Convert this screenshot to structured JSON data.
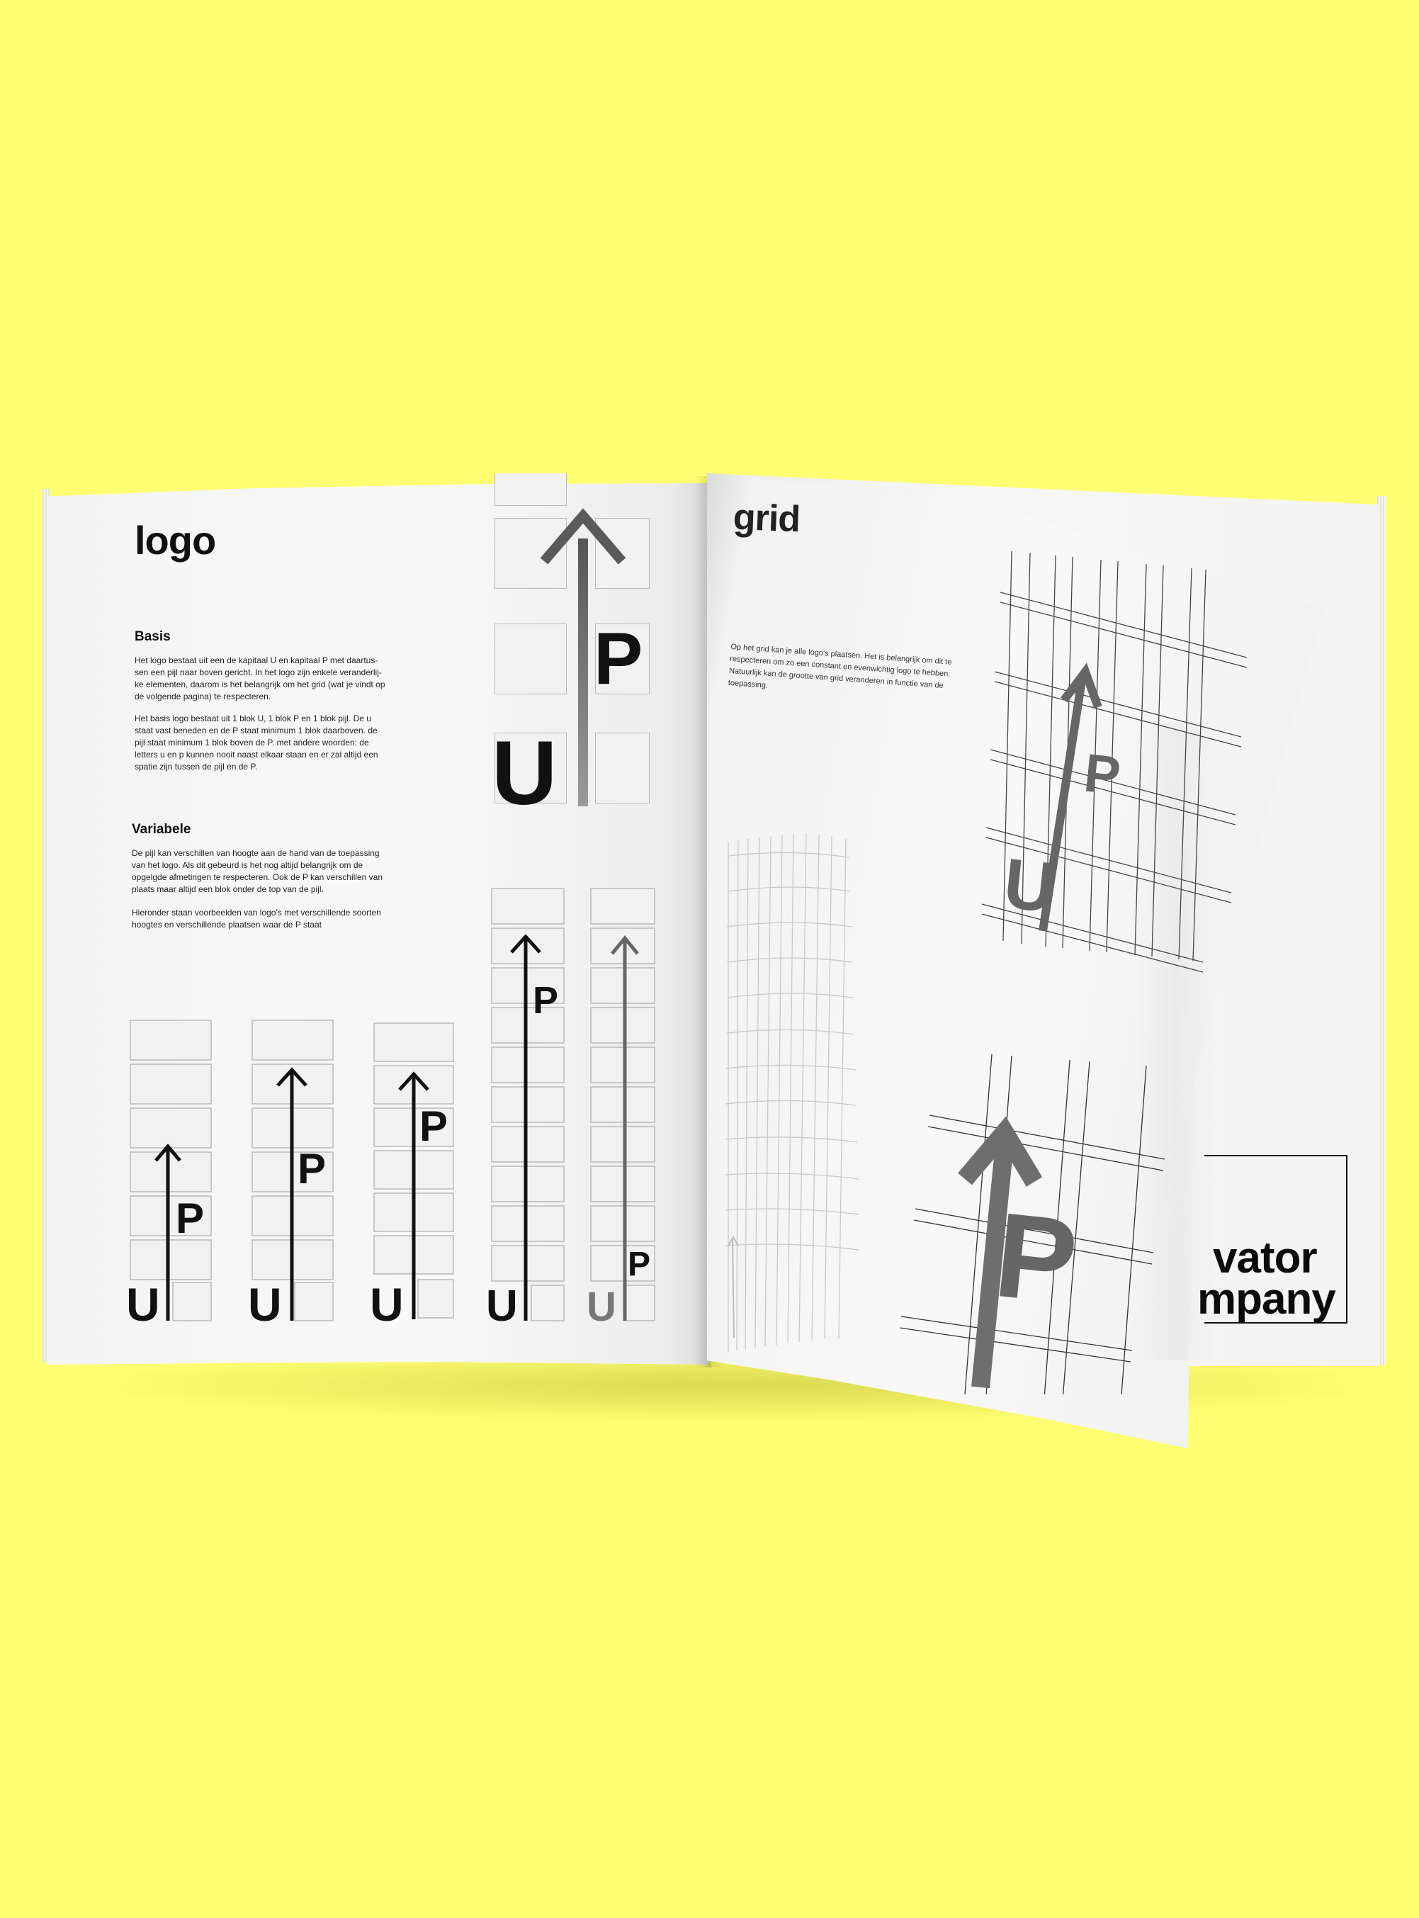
{
  "left_page": {
    "title": "logo",
    "basis": {
      "heading": "Basis",
      "lines_1": [
        "Het logo bestaat uit een de kapitaal U en kapitaal P met daartus-",
        "sen een pijl naar boven gericht. In het logo zijn enkele veranderlij-",
        "ke elementen, daarom is het belangrijk om het grid (wat je vindt op",
        "de volgende pagina) te respecteren."
      ],
      "lines_2": [
        "Het basis logo bestaat uit 1 blok U, 1 blok P en 1 blok pijl. De u",
        "staat vast beneden en de P staat minimum 1 blok daarboven. de",
        "pijl staat minimum 1 blok boven de P. met andere woorden: de",
        "letters u en p kunnen nooit naast elkaar staan en er zal altijd een",
        "spatie zijn tussen de pijl en de P."
      ]
    },
    "variabele": {
      "heading": "Variabele",
      "lines_1": [
        "De pijl kan verschillen van hoogte aan de hand van de toepassing",
        "van het logo. Als dit gebeurd is het nog altijd belangrijk om de",
        "opgelgde afmetingen te respecteren. Ook de P kan verschillen van",
        "plaats maar altijd een blok onder de top van de pijl."
      ],
      "lines_2": [
        "Hieronder staan voorbeelden van logo's met verschillende soorten",
        "hoogtes en verschillende plaatsen waar de P staat"
      ]
    },
    "logo_letters": {
      "u": "U",
      "p": "P"
    }
  },
  "right_page": {
    "title": "grid",
    "lines": [
      "Op het grid kan je alle logo's plaatsen. Het is belangrijk om dit te",
      "respecteren om zo een constant en evenwichtig logo te hebben.",
      "Natuurlijk kan de grootte van grid veranderen in functie van de",
      "toepassing."
    ],
    "grid_letters": {
      "u": "U",
      "p": "P"
    },
    "underlying_page": {
      "line_1": "vator",
      "line_2": "mpany"
    }
  },
  "colors": {
    "background": "#ffff73",
    "paper": "#f6f6f6",
    "ink": "#111111"
  }
}
